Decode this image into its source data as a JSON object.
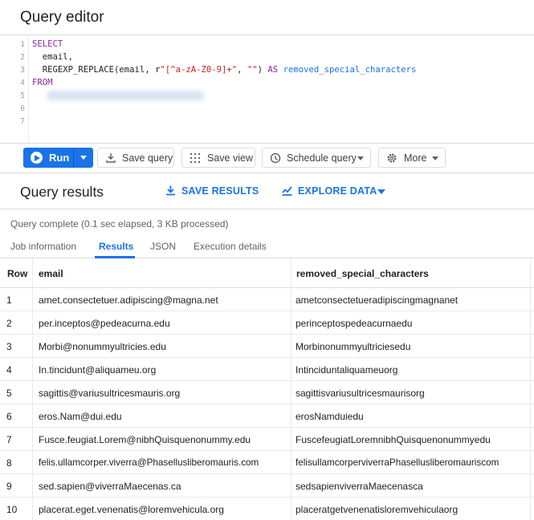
{
  "editor": {
    "title": "Query editor",
    "line_numbers": [
      "1",
      "2",
      "3",
      "4",
      "5",
      "6",
      "7"
    ],
    "lines": {
      "l1_kw": "SELECT",
      "l2": "  email,",
      "l3_fn": "  REGEXP_REPLACE(email, r",
      "l3_str": "\"[^a-zA-Z0-9]+\"",
      "l3_mid": ", ",
      "l3_str2": "\"\"",
      "l3_close": ") ",
      "l3_as": "AS",
      "l3_alias": " removed_special_characters",
      "l4_kw": "FROM"
    }
  },
  "toolbar": {
    "run_label": "Run",
    "save_query_label": "Save query",
    "save_view_label": "Save view",
    "schedule_query_label": "Schedule query",
    "more_label": "More"
  },
  "results": {
    "title": "Query results",
    "save_results_label": "SAVE RESULTS",
    "explore_data_label": "EXPLORE DATA",
    "status": "Query complete (0.1 sec elapsed, 3 KB processed)",
    "tabs": [
      "Job information",
      "Results",
      "JSON",
      "Execution details"
    ],
    "active_tab": "Results"
  },
  "table": {
    "headers": [
      "Row",
      "email",
      "removed_special_characters"
    ],
    "rows": [
      [
        "1",
        "amet.consectetuer.adipiscing@magna.net",
        "ametconsectetueradipiscingmagnanet"
      ],
      [
        "2",
        "per.inceptos@pedeacurna.edu",
        "perinceptospedeacurnaedu"
      ],
      [
        "3",
        "Morbi@nonummyultricies.edu",
        "Morbinonummyultriciesedu"
      ],
      [
        "4",
        "In.tincidunt@aliquameu.org",
        "Intinciduntaliquameuorg"
      ],
      [
        "5",
        "sagittis@variusultricesmauris.org",
        "sagittisvariusultricesmaurisorg"
      ],
      [
        "6",
        "eros.Nam@dui.edu",
        "erosNamduiedu"
      ],
      [
        "7",
        "Fusce.feugiat.Lorem@nibhQuisquenonummy.edu",
        "FuscefeugiatLoremnibhQuisquenonummyedu"
      ],
      [
        "8",
        "felis.ullamcorper.viverra@Phasellusliberomauris.com",
        "felisullamcorperviverraPhasellusliberomauriscom"
      ],
      [
        "9",
        "sed.sapien@viverraMaecenas.ca",
        "sedsapienviverraMaecenasca"
      ],
      [
        "10",
        "placerat.eget.venenatis@loremvehicula.org",
        "placeratgetvenenatisloremvehiculaorg"
      ]
    ]
  },
  "colors": {
    "accent": "#1a73e8",
    "keyword": "#8e24aa",
    "string": "#c5221f"
  },
  "icons": [
    "play-icon",
    "save-icon",
    "grid-icon",
    "clock-icon",
    "gear-icon",
    "download-icon",
    "chart-icon"
  ]
}
